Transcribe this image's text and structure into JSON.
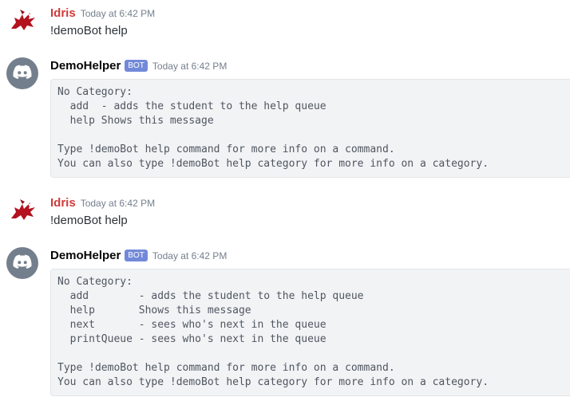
{
  "messages": [
    {
      "author": "Idris",
      "timestamp": "Today at 6:42 PM",
      "text": "!demoBot help"
    },
    {
      "author": "DemoHelper",
      "bot_tag": "BOT",
      "timestamp": "Today at 6:42 PM",
      "code_lines": [
        "No Category:",
        "  add  - adds the student to the help queue",
        "  help Shows this message",
        "",
        "Type !demoBot help command for more info on a command.",
        "You can also type !demoBot help category for more info on a category."
      ]
    },
    {
      "author": "Idris",
      "timestamp": "Today at 6:42 PM",
      "text": "!demoBot help"
    },
    {
      "author": "DemoHelper",
      "bot_tag": "BOT",
      "timestamp": "Today at 6:42 PM",
      "code_lines": [
        "No Category:",
        "  add        - adds the student to the help queue",
        "  help       Shows this message",
        "  next       - sees who's next in the queue",
        "  printQueue - sees who's next in the queue",
        "",
        "Type !demoBot help command for more info on a command.",
        "You can also type !demoBot help category for more info on a category."
      ]
    }
  ],
  "colors": {
    "user_name": "#d13a3a",
    "bot_name": "#060607",
    "bot_tag_bg": "#7289da",
    "timestamp": "#747f8d",
    "code_bg": "#f2f3f5",
    "discord_avatar_bg": "#747f8d"
  },
  "icons": {
    "user_avatar": "red-dragon-icon",
    "bot_avatar": "discord-logo-icon"
  }
}
